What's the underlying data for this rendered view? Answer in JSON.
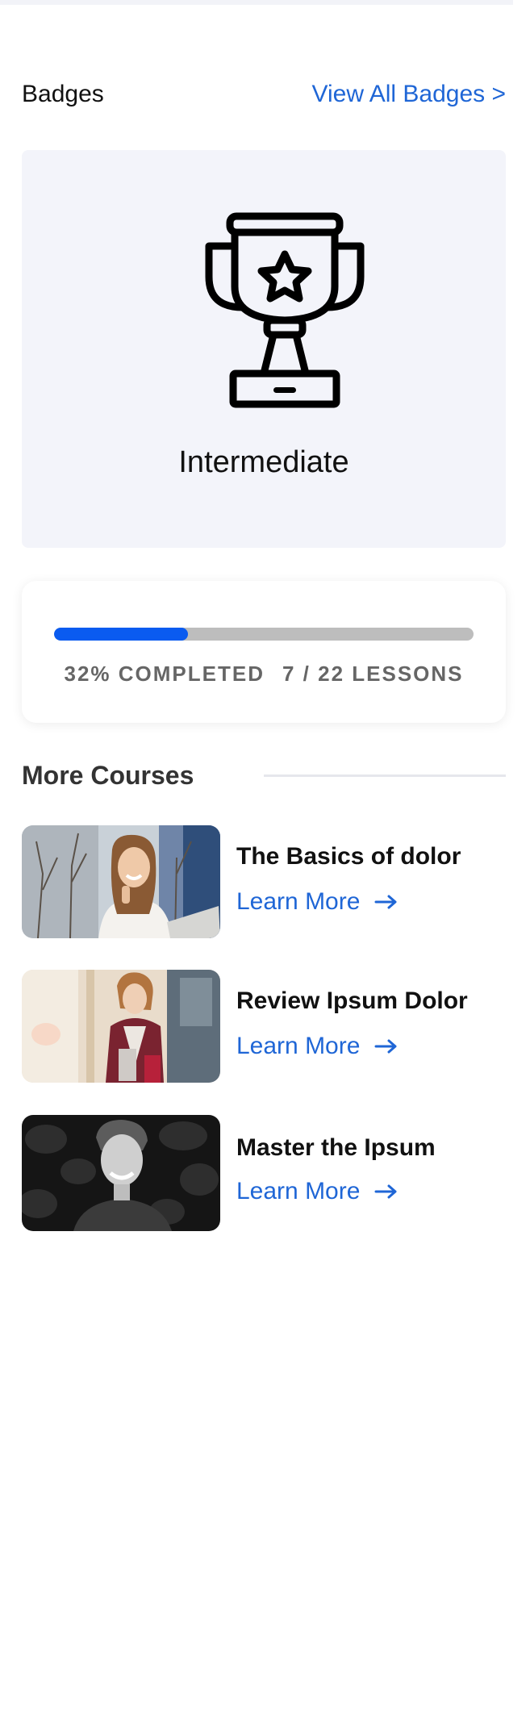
{
  "badges": {
    "title": "Badges",
    "view_all_label": "View All Badges >",
    "current_badge": {
      "name": "Intermediate",
      "icon": "trophy-icon"
    }
  },
  "progress": {
    "completed_text": "32% COMPLETED",
    "lessons_text": "7 / 22 LESSONS",
    "percent": 32,
    "lessons_done": 7,
    "lessons_total": 22,
    "fill_color": "#0a5bf0",
    "track_color": "#bdbdbd"
  },
  "more_courses": {
    "title": "More Courses",
    "items": [
      {
        "title": "The Basics of dolor",
        "link_label": "Learn More",
        "link_icon": "arrow-right-icon",
        "image": "woman-on-phone-with-laptop"
      },
      {
        "title": "Review Ipsum Dolor",
        "link_label": "Learn More",
        "link_icon": "arrow-right-icon",
        "image": "woman-with-shopping-bags"
      },
      {
        "title": "Master the Ipsum",
        "link_label": "Learn More",
        "link_icon": "arrow-right-icon",
        "image": "smiling-man-black-and-white"
      }
    ]
  },
  "colors": {
    "accent": "#1f66d6",
    "card_background": "#f3f4fa"
  }
}
